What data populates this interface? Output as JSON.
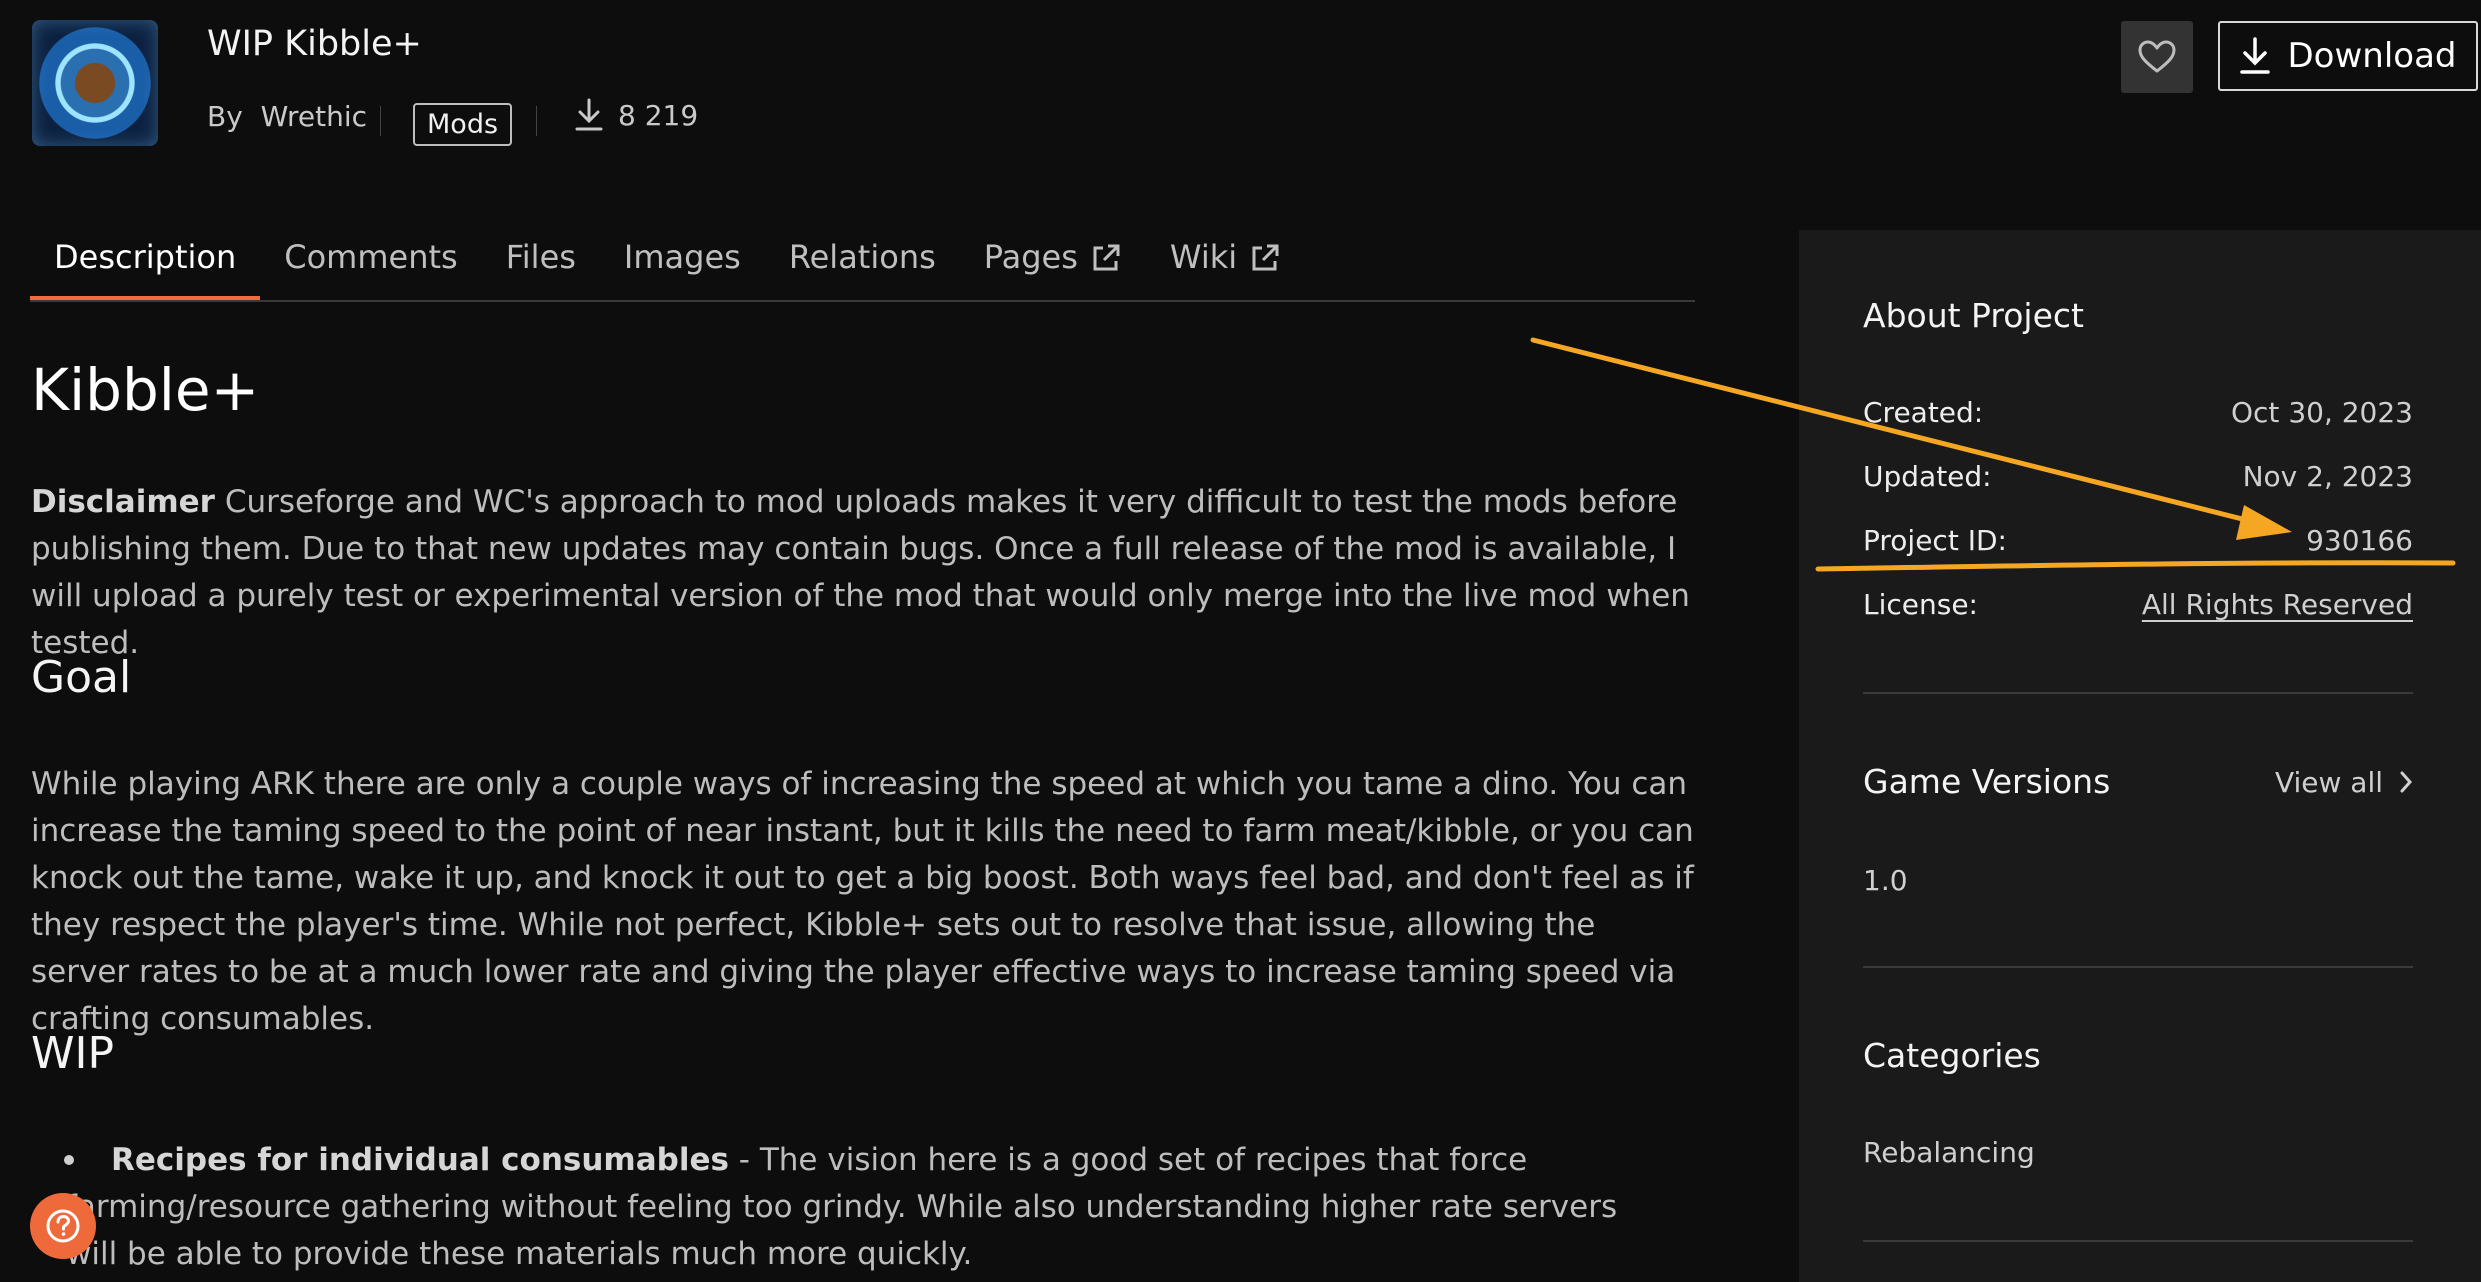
{
  "header": {
    "title": "WIP Kibble+",
    "by_label": "By",
    "author": "Wrethic",
    "category_badge": "Mods",
    "download_count": "8 219",
    "download_button": "Download"
  },
  "tabs": [
    {
      "label": "Description",
      "active": true
    },
    {
      "label": "Comments"
    },
    {
      "label": "Files"
    },
    {
      "label": "Images"
    },
    {
      "label": "Relations"
    },
    {
      "label": "Pages"
    },
    {
      "label": "Wiki"
    }
  ],
  "content": {
    "title": "Kibble+",
    "disclaimer_label": "Disclaimer",
    "disclaimer_text": " Curseforge and WC's approach to mod uploads makes it very difficult to test the mods before publishing them. Due to that new updates may contain bugs. Once a full release of the mod is available, I will upload a purely test or experimental version of the mod that would only merge into the live mod when tested.",
    "goal_heading": "Goal",
    "goal_text": "While playing ARK there are only a couple ways of increasing the speed at which you tame a dino. You can increase the taming speed to the point of near instant, but it kills the need to farm meat/kibble, or you can knock out the tame, wake it up, and knock it out to get a big boost. Both ways feel bad, and don't feel as if they respect the player's time. While not perfect, Kibble+ sets out to resolve that issue, allowing the server rates to be at a much lower rate and giving the player effective ways to increase taming speed via crafting consumables.",
    "wip_heading": "WIP",
    "wip_item_label": "Recipes for individual consumables",
    "wip_item_text": " - The vision here is a good set of recipes that force farming/resource gathering without feeling too grindy. While also understanding higher rate servers will be able to provide these materials much more quickly."
  },
  "sidebar": {
    "about_heading": "About Project",
    "created_label": "Created:",
    "created_value": "Oct 30, 2023",
    "updated_label": "Updated:",
    "updated_value": "Nov 2, 2023",
    "project_id_label": "Project ID:",
    "project_id_value": "930166",
    "license_label": "License:",
    "license_value": "All Rights Reserved",
    "game_versions_heading": "Game Versions",
    "view_all": "View all",
    "game_version": "1.0",
    "categories_heading": "Categories",
    "category": "Rebalancing"
  },
  "colors": {
    "accent": "#f26b3a",
    "annotation": "#f5a623",
    "background": "#0d0d0d",
    "sidebar_bg": "#1a1a1a"
  }
}
